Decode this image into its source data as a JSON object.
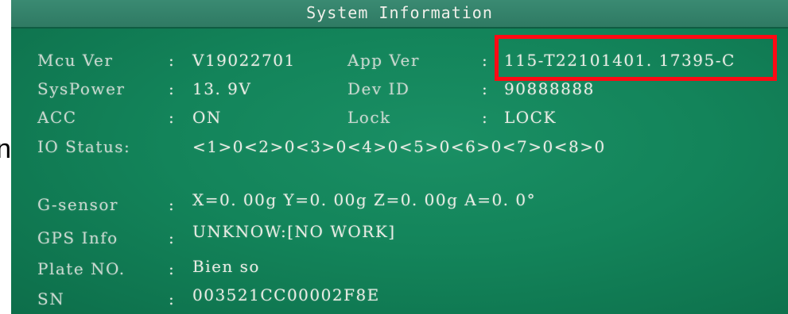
{
  "stray_text": "n",
  "window": {
    "title": "System Information"
  },
  "highlight_color": "#ff0a14",
  "info": {
    "mcu": {
      "label": "Mcu Ver",
      "sep": ":",
      "value": "V19022701"
    },
    "app": {
      "label": "App Ver",
      "sep": ":",
      "value": "115-T22101401. 17395-C"
    },
    "syspower": {
      "label": "SysPower",
      "sep": ":",
      "value": "13. 9V"
    },
    "devid": {
      "label": "Dev ID",
      "sep": ":",
      "value": "90888888"
    },
    "acc": {
      "label": "ACC",
      "sep": ":",
      "value": "ON"
    },
    "lock": {
      "label": "Lock",
      "sep": ":",
      "value": "LOCK"
    },
    "io": {
      "label": "IO Status:",
      "value": "<1>0<2>0<3>0<4>0<5>0<6>0<7>0<8>0"
    },
    "gsensor": {
      "label": "G-sensor",
      "sep": ":",
      "value": "X=0. 00g Y=0. 00g Z=0. 00g A=0. 0°"
    },
    "gps": {
      "label": "GPS Info",
      "sep": ":",
      "value": "UNKNOW:[NO WORK]"
    },
    "plate": {
      "label": "Plate NO.",
      "sep": ":",
      "value": "Bien so"
    },
    "sn": {
      "label": "SN",
      "sep": ":",
      "value": "003521CC00002F8E"
    }
  }
}
